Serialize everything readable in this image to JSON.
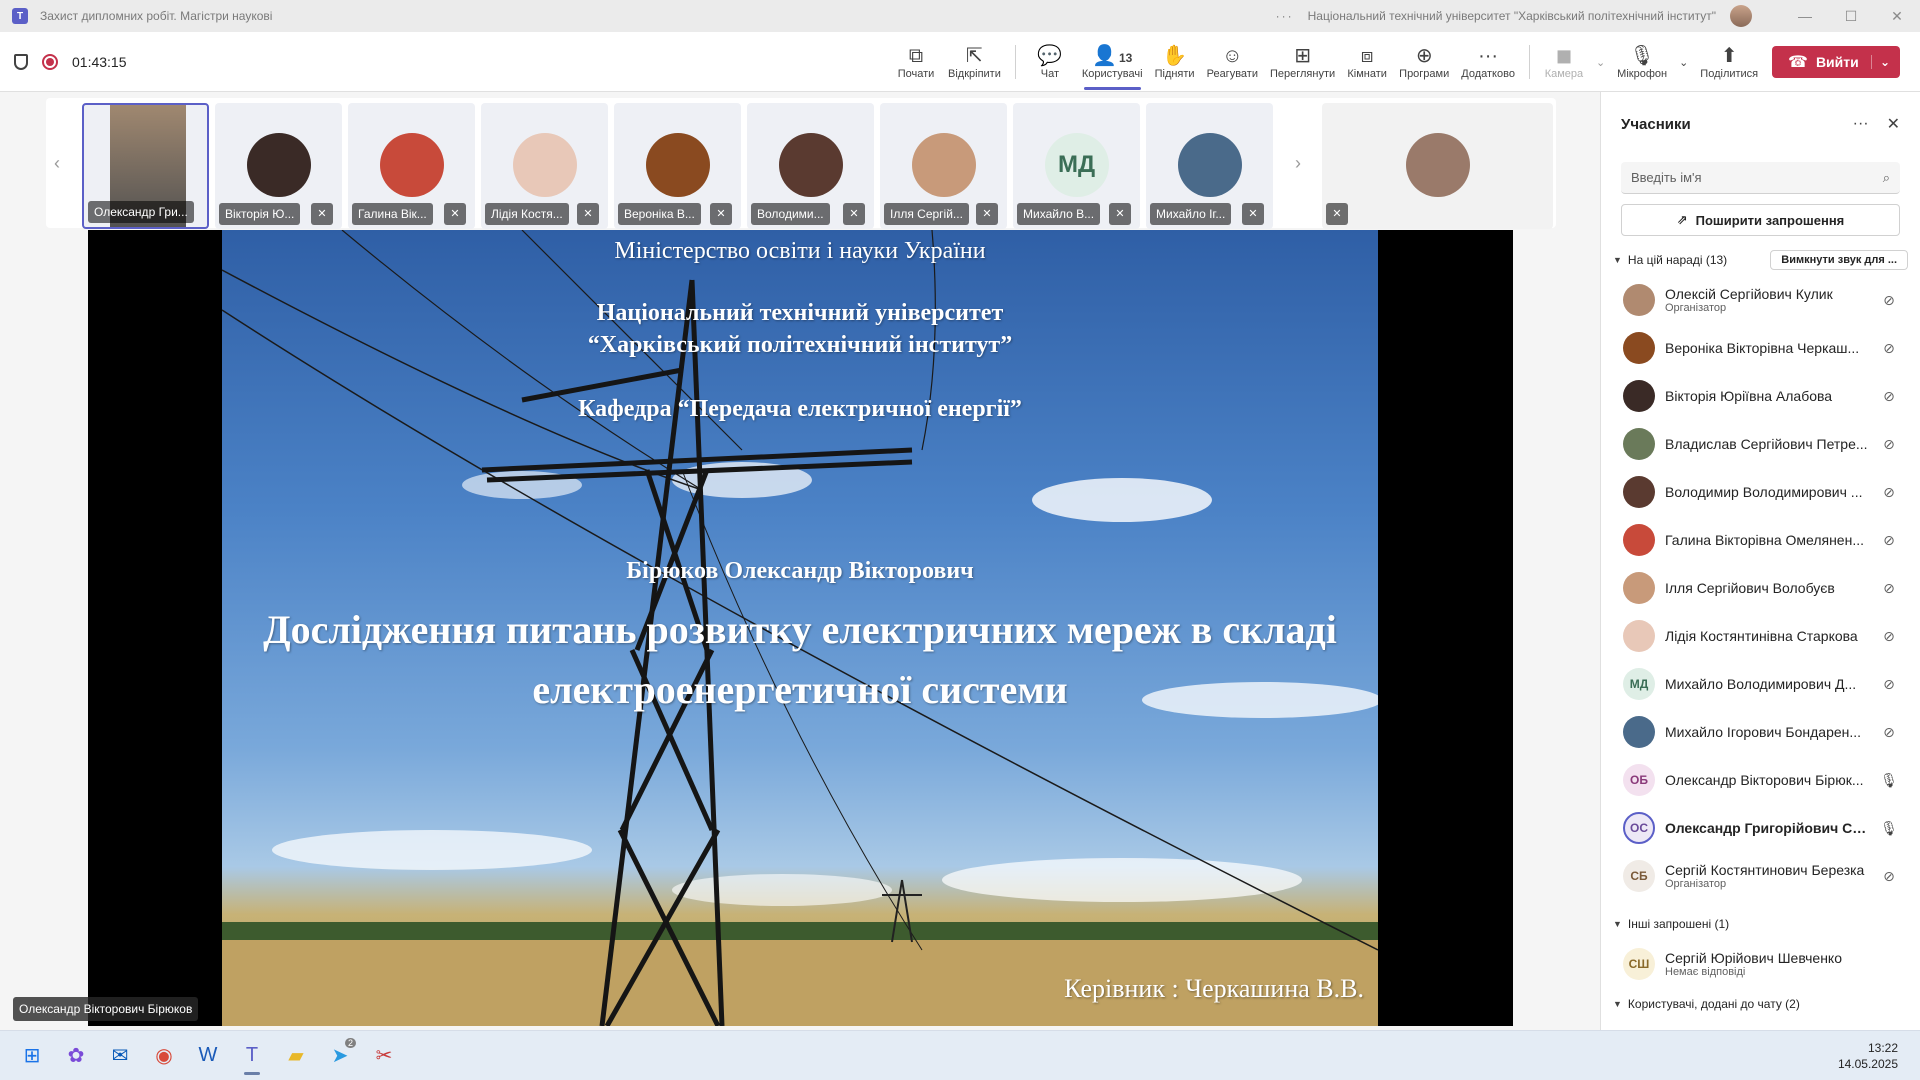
{
  "window": {
    "title": "Захист дипломних робіт. Магістри наукові",
    "org": "Національний технічний університет \"Харківський політехнічний інститут\"",
    "dots": "···",
    "app_letter": "T",
    "min": "—",
    "max": "☐",
    "close": "✕"
  },
  "toolbar": {
    "timer": "01:43:15",
    "tools": [
      {
        "label": "Почати",
        "icon": "⧉"
      },
      {
        "label": "Відкріпити",
        "icon": "⇱"
      },
      {
        "label": "Чат",
        "icon": "💬"
      },
      {
        "label": "Користувачі",
        "icon": "👤",
        "count": "13"
      },
      {
        "label": "Підняти",
        "icon": "✋"
      },
      {
        "label": "Реагувати",
        "icon": "☺"
      },
      {
        "label": "Переглянути",
        "icon": "⊞"
      },
      {
        "label": "Кімнати",
        "icon": "⧈"
      },
      {
        "label": "Програми",
        "icon": "⊕"
      },
      {
        "label": "Додатково",
        "icon": "···"
      }
    ],
    "camera_label": "Камера",
    "mic_label": "Мікрофон",
    "share_label": "Поділитися",
    "leave_label": "Вийти"
  },
  "participants_strip": [
    {
      "label": "Олександр Гри...",
      "color": "#6b6b6b"
    },
    {
      "label": "Вікторія Ю...",
      "color": "#3a2a26"
    },
    {
      "label": "Галина Вік...",
      "color": "#c84a3a"
    },
    {
      "label": "Лідія Костя...",
      "color": "#e8c8b8"
    },
    {
      "label": "Вероніка В...",
      "color": "#8a4a20"
    },
    {
      "label": "Володими...",
      "color": "#5a3a30"
    },
    {
      "label": "Ілля Сергій...",
      "color": "#c89a7a"
    },
    {
      "label": "Михайло В...",
      "initials": "МД"
    },
    {
      "label": "Михайло Іг...",
      "color": "#4a6a8a"
    },
    {
      "label": "",
      "color": "#9a7a6a"
    }
  ],
  "slide": {
    "line1": "Міністерство освіти і науки України",
    "line2": "Національний технічний університет",
    "line3": "“Харківський політехнічний інститут”",
    "line4": "Кафедра “Передача електричної енергії”",
    "author": "Бірюков Олександр Вікторович",
    "topic": "Дослідження питань розвитку електричних мереж в складі електроенергетичної системи",
    "supervisor": "Керівник : Черкашина В.В."
  },
  "speaker_label": "Олександр Вікторович Бірюков",
  "panel": {
    "title": "Учасники",
    "more": "···",
    "close": "✕",
    "search_placeholder": "Введіть ім'я",
    "invite_label": "Поширити запрошення",
    "in_meeting": "На цій нараді (13)",
    "mute_all": "Вимкнути звук для ...",
    "people": [
      {
        "name": "Олексій Сергійович Кулик",
        "role": "Організатор",
        "color": "#b08a70"
      },
      {
        "name": "Вероніка Вікторівна Черкаш...",
        "role": "",
        "color": "#8a4a20"
      },
      {
        "name": "Вікторія Юріївна Алабова",
        "role": "",
        "color": "#3a2a26"
      },
      {
        "name": "Владислав Сергійович Петре...",
        "role": "",
        "color": "#6a7a5a"
      },
      {
        "name": "Володимир Володимирович ...",
        "role": "",
        "color": "#5a3a30"
      },
      {
        "name": "Галина Вікторівна Омелянен...",
        "role": "",
        "color": "#c84a3a"
      },
      {
        "name": "Ілля Сергійович Волобуєв",
        "role": "",
        "color": "#c89a7a"
      },
      {
        "name": "Лідія Костянтинівна Старкова",
        "role": "",
        "color": "#e8c8b8"
      },
      {
        "name": "Михайло Володимирович Д...",
        "role": "",
        "initials": "МД",
        "bg": "#dfeee6",
        "fg": "#3b6e56"
      },
      {
        "name": "Михайло Ігорович Бондарен...",
        "role": "",
        "color": "#4a6a8a"
      },
      {
        "name": "Олександр Вікторович Бірюк...",
        "role": "",
        "initials": "ОБ",
        "bg": "#f3e1ef",
        "fg": "#8a3a7a",
        "mic_on": true
      },
      {
        "name": "Олександр Григорійович Се...",
        "role": "",
        "initials": "ОС",
        "bg": "#ede8f6",
        "fg": "#6a4a9a",
        "mic_on": true,
        "bold": true
      },
      {
        "name": "Сергій Костянтинович Березка",
        "role": "Організатор",
        "initials": "СБ",
        "bg": "#f0ebe6",
        "fg": "#7a5a3a"
      }
    ],
    "others": "Інші запрошені (1)",
    "other_person": {
      "name": "Сергій Юрійович Шевченко",
      "role": "Немає відповіді",
      "initials": "СШ",
      "bg": "#f8f0d8",
      "fg": "#8a6a2a"
    },
    "chat_users": "Користувачі, додані до чату (2)"
  },
  "taskbar": {
    "time": "13:22",
    "date": "14.05.2025",
    "telegram_badge": "2"
  }
}
